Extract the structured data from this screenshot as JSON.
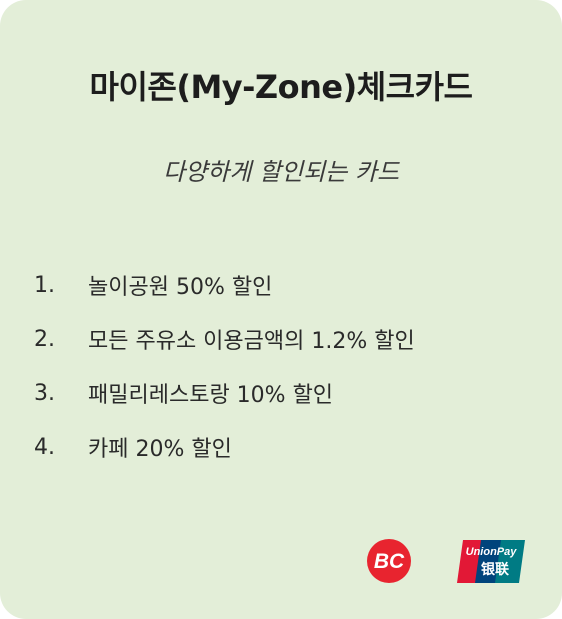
{
  "card": {
    "title": "마이존(My-Zone)체크카드",
    "subtitle": "다양하게 할인되는 카드",
    "benefits": [
      {
        "num": "1.",
        "text": "놀이공원 50% 할인"
      },
      {
        "num": "2.",
        "text": "모든 주유소 이용금액의 1.2% 할인"
      },
      {
        "num": "3.",
        "text": "패밀리레스토랑 10% 할인"
      },
      {
        "num": "4.",
        "text": "카페 20% 할인"
      }
    ]
  },
  "logos": {
    "bc_text": "BC",
    "unionpay_text": "UnionPay",
    "unionpay_chinese": "银联"
  },
  "colors": {
    "card_background": "#e3eed8",
    "bc_red": "#e8242f",
    "unionpay_red": "#e21836",
    "unionpay_blue": "#00447c",
    "unionpay_teal": "#007b84"
  }
}
